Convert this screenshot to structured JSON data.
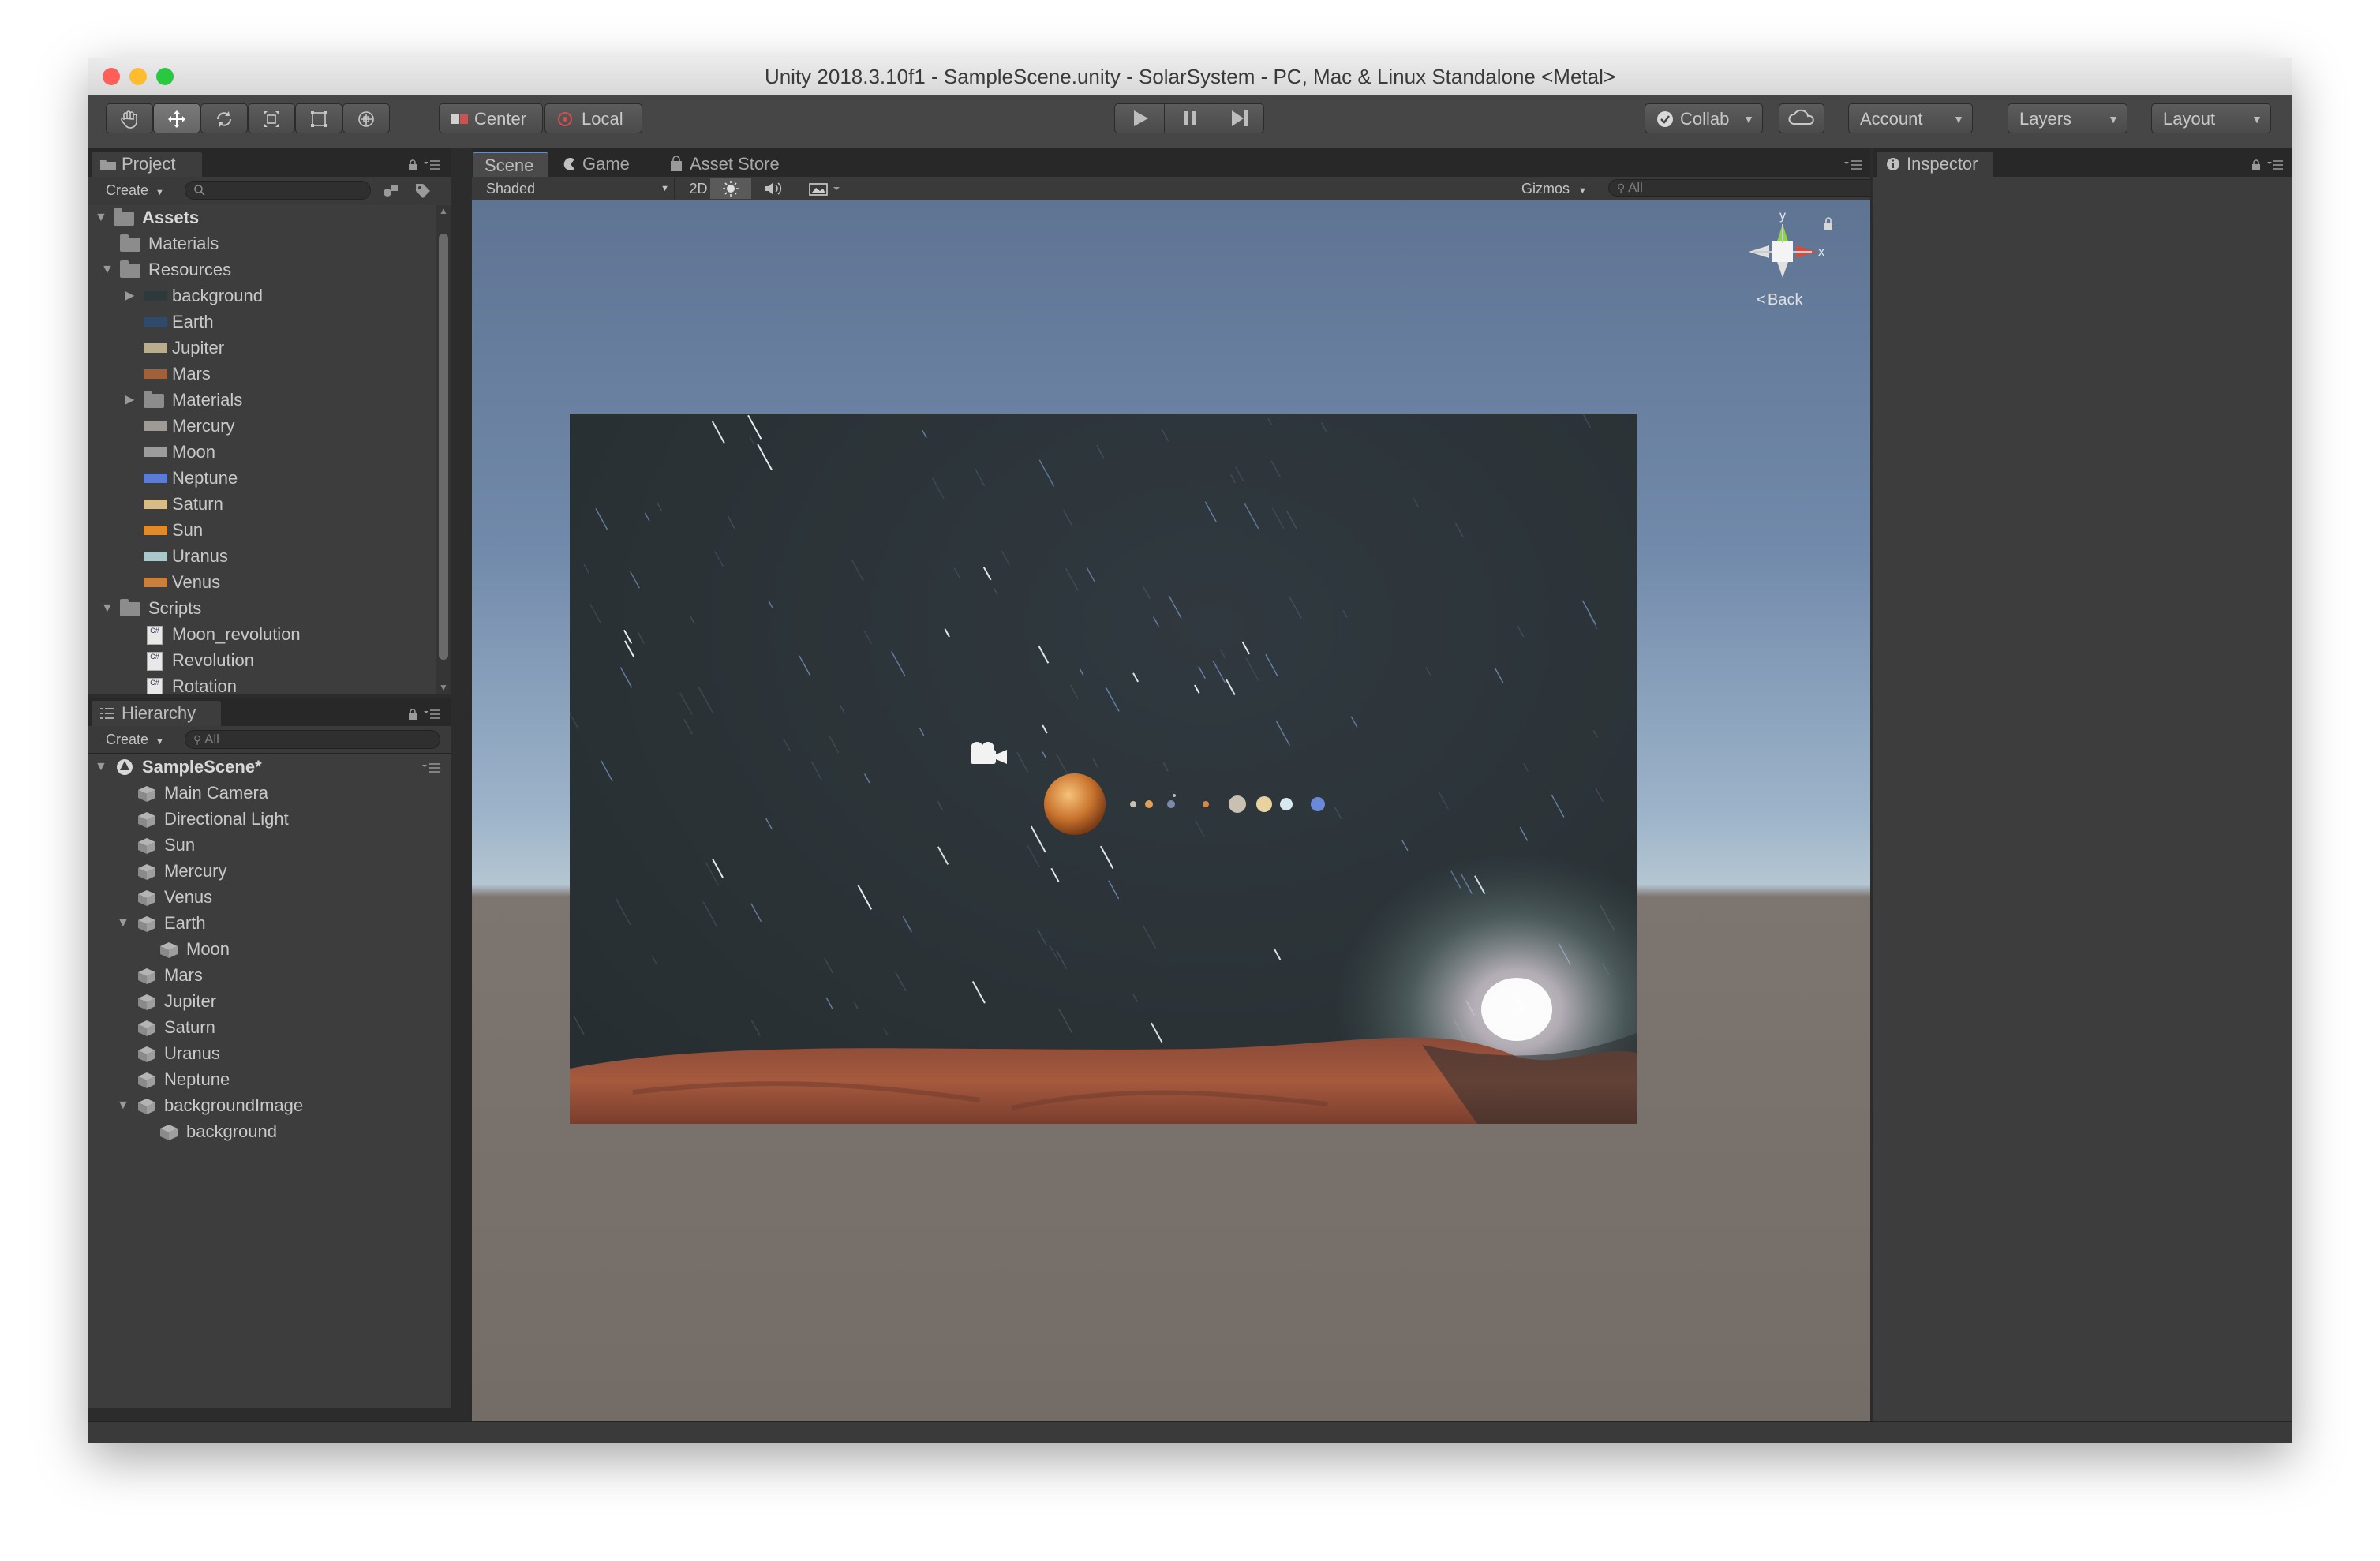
{
  "window": {
    "title": "Unity 2018.3.10f1 - SampleScene.unity - SolarSystem - PC, Mac & Linux Standalone <Metal>",
    "traffic_lights": [
      "#fe5f57",
      "#febc2e",
      "#28c840"
    ]
  },
  "toolbar": {
    "tools": [
      "hand-icon",
      "move-icon",
      "rotate-icon",
      "scale-icon",
      "rect-icon",
      "transform-icon"
    ],
    "pivot_label": "Center",
    "space_label": "Local",
    "collab_label": "Collab",
    "account_label": "Account",
    "layers_label": "Layers",
    "layout_label": "Layout"
  },
  "project_panel": {
    "tab": "Project",
    "create": "Create",
    "assets_root": "Assets",
    "items": [
      {
        "label": "Materials",
        "type": "folder",
        "indent": 1,
        "arrow": ""
      },
      {
        "label": "Resources",
        "type": "folder",
        "indent": 1,
        "arrow": "▼"
      },
      {
        "label": "background",
        "type": "texture",
        "indent": 2,
        "arrow": "▶",
        "color": "#2c3a3c"
      },
      {
        "label": "Earth",
        "type": "texture",
        "indent": 2,
        "arrow": "",
        "color": "#2f4a6a"
      },
      {
        "label": "Jupiter",
        "type": "texture",
        "indent": 2,
        "arrow": "",
        "color": "#b9ad8c"
      },
      {
        "label": "Mars",
        "type": "texture",
        "indent": 2,
        "arrow": "",
        "color": "#a0603a"
      },
      {
        "label": "Materials",
        "type": "folder",
        "indent": 2,
        "arrow": "▶"
      },
      {
        "label": "Mercury",
        "type": "texture",
        "indent": 2,
        "arrow": "",
        "color": "#a09a94"
      },
      {
        "label": "Moon",
        "type": "texture",
        "indent": 2,
        "arrow": "",
        "color": "#9c9c9c"
      },
      {
        "label": "Neptune",
        "type": "texture",
        "indent": 2,
        "arrow": "",
        "color": "#5a7bd6"
      },
      {
        "label": "Saturn",
        "type": "texture",
        "indent": 2,
        "arrow": "",
        "color": "#d9bb86"
      },
      {
        "label": "Sun",
        "type": "texture",
        "indent": 2,
        "arrow": "",
        "color": "#e08a2a"
      },
      {
        "label": "Uranus",
        "type": "texture",
        "indent": 2,
        "arrow": "",
        "color": "#a8c8cc"
      },
      {
        "label": "Venus",
        "type": "texture",
        "indent": 2,
        "arrow": "",
        "color": "#c8813c"
      },
      {
        "label": "Scripts",
        "type": "folder",
        "indent": 1,
        "arrow": "▼"
      },
      {
        "label": "Moon_revolution",
        "type": "script",
        "indent": 2,
        "arrow": ""
      },
      {
        "label": "Revolution",
        "type": "script",
        "indent": 2,
        "arrow": ""
      },
      {
        "label": "Rotation",
        "type": "script",
        "indent": 2,
        "arrow": ""
      }
    ]
  },
  "hierarchy_panel": {
    "tab": "Hierarchy",
    "create": "Create",
    "search_placeholder": "All",
    "scene_name": "SampleScene*",
    "items": [
      {
        "label": "Main Camera",
        "indent": 1,
        "arrow": ""
      },
      {
        "label": "Directional Light",
        "indent": 1,
        "arrow": ""
      },
      {
        "label": "Sun",
        "indent": 1,
        "arrow": ""
      },
      {
        "label": "Mercury",
        "indent": 1,
        "arrow": ""
      },
      {
        "label": "Venus",
        "indent": 1,
        "arrow": ""
      },
      {
        "label": "Earth",
        "indent": 1,
        "arrow": "▼"
      },
      {
        "label": "Moon",
        "indent": 2,
        "arrow": ""
      },
      {
        "label": "Mars",
        "indent": 1,
        "arrow": ""
      },
      {
        "label": "Jupiter",
        "indent": 1,
        "arrow": ""
      },
      {
        "label": "Saturn",
        "indent": 1,
        "arrow": ""
      },
      {
        "label": "Uranus",
        "indent": 1,
        "arrow": ""
      },
      {
        "label": "Neptune",
        "indent": 1,
        "arrow": ""
      },
      {
        "label": "backgroundImage",
        "indent": 1,
        "arrow": "▼"
      },
      {
        "label": "background",
        "indent": 2,
        "arrow": ""
      }
    ]
  },
  "scene_panel": {
    "tabs": [
      "Scene",
      "Game",
      "Asset Store"
    ],
    "shading": "Shaded",
    "mode_2d": "2D",
    "gizmos": "Gizmos",
    "search_placeholder": "All",
    "gizmo": {
      "y": "y",
      "x": "x",
      "back": "Back"
    }
  },
  "inspector_panel": {
    "tab": "Inspector"
  }
}
